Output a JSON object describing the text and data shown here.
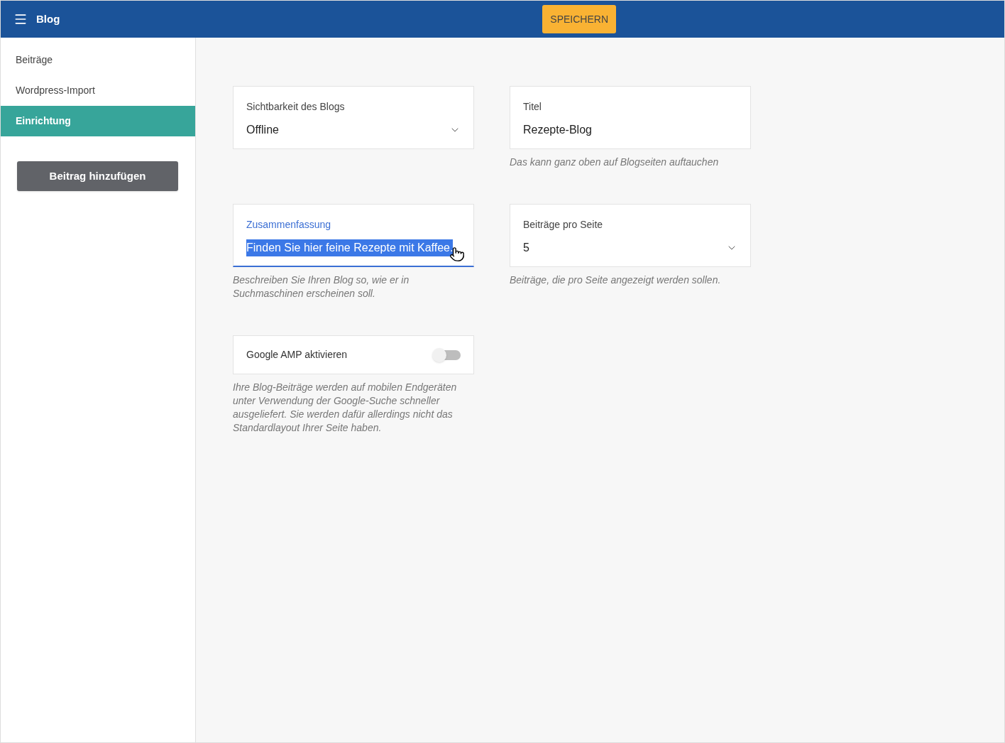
{
  "header": {
    "title": "Blog",
    "save_button": "SPEICHERN"
  },
  "sidebar": {
    "items": [
      {
        "label": "Beiträge",
        "selected": false
      },
      {
        "label": "Wordpress-Import",
        "selected": false
      },
      {
        "label": "Einrichtung",
        "selected": true
      }
    ],
    "add_button": "Beitrag hinzufügen"
  },
  "fields": [
    {
      "kind": "select",
      "label": "Sichtbarkeit des Blogs",
      "value": "Offline",
      "focused": false
    },
    {
      "kind": "text",
      "label": "Titel",
      "value": "Rezepte-Blog",
      "hint": "Das kann ganz oben auf Blogseiten auftauchen",
      "focused": false
    },
    {
      "kind": "text",
      "label": "Zusammenfassung",
      "value": "Finden Sie hier feine Rezepte mit Kaffee.",
      "hint": "Beschreiben Sie Ihren Blog so, wie er in Suchmaschinen erscheinen soll.",
      "focused": true
    },
    {
      "kind": "select",
      "label": "Beiträge pro Seite",
      "value": "5",
      "hint": "Beiträge, die pro Seite angezeigt werden sollen.",
      "focused": false
    }
  ],
  "toggle": {
    "label": "Google AMP aktivieren",
    "on": false,
    "hint": "Ihre Blog-Beiträge werden auf mobilen Endgeräten unter Verwendung der Google-Suche schneller ausgeliefert. Sie werden dafür allerdings nicht das Standardlayout Ihrer Seite haben."
  }
}
